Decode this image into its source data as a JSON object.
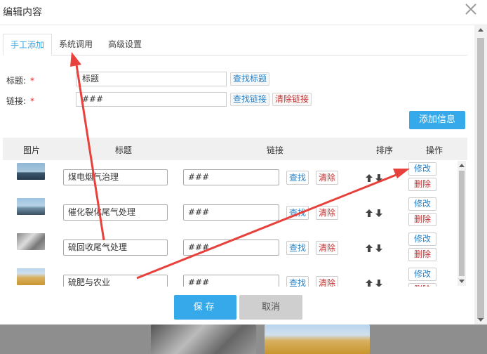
{
  "dialog": {
    "title": "编辑内容"
  },
  "tabs": [
    {
      "label": "手工添加",
      "active": true
    },
    {
      "label": "系统调用",
      "active": false
    },
    {
      "label": "高级设置",
      "active": false
    }
  ],
  "form": {
    "title_label": "标题:",
    "title_value": "标题",
    "link_label": "链接:",
    "link_value": "###",
    "required_mark": "*",
    "find_title_btn": "查找标题",
    "find_link_btn": "查找链接",
    "clear_link_btn": "清除链接"
  },
  "add_info_btn": "添加信息",
  "table": {
    "headers": [
      "图片",
      "标题",
      "链接",
      "排序",
      "操作"
    ],
    "rows": [
      {
        "title": "煤电烟气治理",
        "link": "###",
        "find": "查找",
        "clear": "清除",
        "edit": "修改",
        "delete": "删除"
      },
      {
        "title": "催化裂化尾气处理",
        "link": "###",
        "find": "查找",
        "clear": "清除",
        "edit": "修改",
        "delete": "删除"
      },
      {
        "title": "硫回收尾气处理",
        "link": "###",
        "find": "查找",
        "clear": "清除",
        "edit": "修改",
        "delete": "删除"
      },
      {
        "title": "硫肥与农业",
        "link": "###",
        "find": "查找",
        "clear": "清除",
        "edit": "修改",
        "delete": "删除"
      }
    ]
  },
  "footer": {
    "save": "保存",
    "cancel": "取消"
  },
  "colors": {
    "accent": "#36a9ea",
    "danger": "#c53030",
    "annotation": "#e8413c"
  },
  "icons": {
    "close": "close-icon",
    "sort_up": "arrow-up-icon",
    "sort_down": "arrow-down-icon"
  }
}
